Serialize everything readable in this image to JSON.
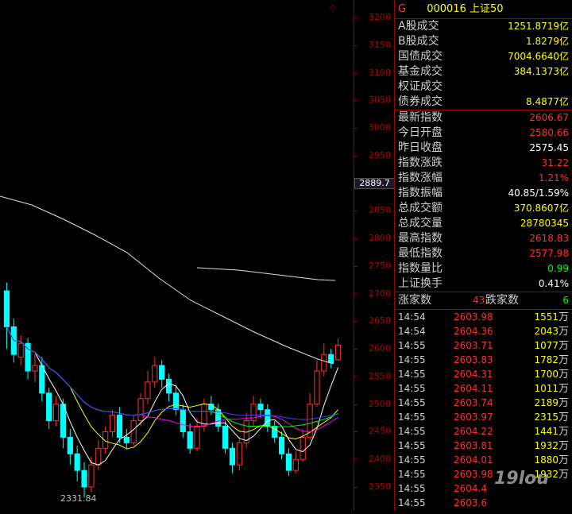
{
  "header": {
    "marker": "G",
    "title": "000016 上证50"
  },
  "axis": {
    "ticks": [
      "3200",
      "3150",
      "3100",
      "3050",
      "3000",
      "2950",
      "2900",
      "2850",
      "2800",
      "2750",
      "2700",
      "2650",
      "2600",
      "2550",
      "2500",
      "2450",
      "2400",
      "2350"
    ],
    "current_price_label": "2889.7",
    "low_label": "2331.84"
  },
  "stats": [
    {
      "label": "A股成交",
      "value": "1251.8719亿",
      "color": "yellow"
    },
    {
      "label": "B股成交",
      "value": "1.8279亿",
      "color": "yellow"
    },
    {
      "label": "国债成交",
      "value": "7004.6640亿",
      "color": "yellow"
    },
    {
      "label": "基金成交",
      "value": "384.1373亿",
      "color": "yellow"
    },
    {
      "label": "权证成交",
      "value": "",
      "color": "yellow"
    },
    {
      "label": "债券成交",
      "value": "8.4877亿",
      "color": "yellow"
    }
  ],
  "index": [
    {
      "label": "最新指数",
      "value": "2606.67",
      "color": "red"
    },
    {
      "label": "今日开盘",
      "value": "2580.66",
      "color": "red"
    },
    {
      "label": "昨日收盘",
      "value": "2575.45",
      "color": "white"
    },
    {
      "label": "指数涨跌",
      "value": "31.22",
      "color": "red"
    },
    {
      "label": "指数涨幅",
      "value": "1.21%",
      "color": "red"
    },
    {
      "label": "指数振幅",
      "value": "40.85/1.59%",
      "color": "white"
    },
    {
      "label": "总成交额",
      "value": "370.8607亿",
      "color": "yellow"
    },
    {
      "label": "总成交量",
      "value": "28780345",
      "color": "yellow"
    },
    {
      "label": "最高指数",
      "value": "2618.83",
      "color": "red"
    },
    {
      "label": "最低指数",
      "value": "2577.98",
      "color": "red"
    },
    {
      "label": "指数量比",
      "value": "0.99",
      "color": "green"
    },
    {
      "label": "上证换手",
      "value": "0.41%",
      "color": "white"
    }
  ],
  "advance": {
    "up_label": "涨家数",
    "up_value": "43",
    "down_label": "跌家数",
    "down_value": "6"
  },
  "ticks_table": [
    {
      "time": "14:54",
      "price": "2603.98",
      "vol": "1551",
      "unit": "万"
    },
    {
      "time": "14:54",
      "price": "2604.36",
      "vol": "2043",
      "unit": "万"
    },
    {
      "time": "14:55",
      "price": "2603.71",
      "vol": "1077",
      "unit": "万"
    },
    {
      "time": "14:55",
      "price": "2603.83",
      "vol": "1782",
      "unit": "万"
    },
    {
      "time": "14:55",
      "price": "2604.31",
      "vol": "1700",
      "unit": "万"
    },
    {
      "time": "14:55",
      "price": "2604.11",
      "vol": "1011",
      "unit": "万"
    },
    {
      "time": "14:55",
      "price": "2603.74",
      "vol": "2189",
      "unit": "万"
    },
    {
      "time": "14:55",
      "price": "2603.97",
      "vol": "2315",
      "unit": "万"
    },
    {
      "time": "14:55",
      "price": "2604.22",
      "vol": "1441",
      "unit": "万"
    },
    {
      "time": "14:55",
      "price": "2603.81",
      "vol": "1932",
      "unit": "万"
    },
    {
      "time": "14:55",
      "price": "2604.01",
      "vol": "1880",
      "unit": "万"
    },
    {
      "time": "14:55",
      "price": "2603.98",
      "vol": "1932",
      "unit": "万"
    },
    {
      "time": "14:55",
      "price": "2604.4",
      "vol": "",
      "unit": ""
    },
    {
      "time": "14:55",
      "price": "2603.6",
      "vol": "",
      "unit": ""
    }
  ],
  "watermark": "19lou",
  "candles": [
    [
      2705,
      2640,
      2720,
      2600
    ],
    [
      2640,
      2590,
      2655,
      2575
    ],
    [
      2585,
      2610,
      2625,
      2570
    ],
    [
      2610,
      2560,
      2620,
      2545
    ],
    [
      2560,
      2570,
      2590,
      2540
    ],
    [
      2570,
      2520,
      2585,
      2505
    ],
    [
      2520,
      2470,
      2530,
      2455
    ],
    [
      2470,
      2500,
      2515,
      2460
    ],
    [
      2500,
      2440,
      2510,
      2420
    ],
    [
      2440,
      2410,
      2455,
      2390
    ],
    [
      2410,
      2380,
      2425,
      2360
    ],
    [
      2380,
      2350,
      2395,
      2331
    ],
    [
      2350,
      2390,
      2405,
      2340
    ],
    [
      2390,
      2420,
      2435,
      2380
    ],
    [
      2420,
      2450,
      2460,
      2410
    ],
    [
      2450,
      2480,
      2490,
      2440
    ],
    [
      2480,
      2440,
      2495,
      2430
    ],
    [
      2440,
      2430,
      2455,
      2420
    ],
    [
      2430,
      2470,
      2480,
      2425
    ],
    [
      2470,
      2510,
      2520,
      2460
    ],
    [
      2510,
      2540,
      2560,
      2500
    ],
    [
      2540,
      2570,
      2585,
      2530
    ],
    [
      2570,
      2545,
      2580,
      2530
    ],
    [
      2545,
      2520,
      2555,
      2505
    ],
    [
      2520,
      2490,
      2535,
      2480
    ],
    [
      2490,
      2450,
      2500,
      2440
    ],
    [
      2450,
      2420,
      2465,
      2410
    ],
    [
      2420,
      2460,
      2475,
      2415
    ],
    [
      2460,
      2500,
      2510,
      2450
    ],
    [
      2500,
      2490,
      2515,
      2480
    ],
    [
      2490,
      2460,
      2500,
      2450
    ],
    [
      2460,
      2420,
      2470,
      2410
    ],
    [
      2420,
      2390,
      2430,
      2375
    ],
    [
      2390,
      2430,
      2440,
      2380
    ],
    [
      2430,
      2470,
      2485,
      2420
    ],
    [
      2470,
      2500,
      2515,
      2460
    ],
    [
      2500,
      2490,
      2510,
      2475
    ],
    [
      2490,
      2460,
      2500,
      2450
    ],
    [
      2460,
      2440,
      2470,
      2430
    ],
    [
      2440,
      2410,
      2450,
      2400
    ],
    [
      2410,
      2380,
      2420,
      2370
    ],
    [
      2380,
      2400,
      2415,
      2375
    ],
    [
      2400,
      2440,
      2455,
      2395
    ],
    [
      2440,
      2500,
      2520,
      2435
    ],
    [
      2500,
      2560,
      2580,
      2495
    ],
    [
      2560,
      2590,
      2610,
      2550
    ],
    [
      2590,
      2575,
      2600,
      2565
    ],
    [
      2580,
      2607,
      2619,
      2578
    ]
  ],
  "colors": {
    "up": "#ff3030",
    "down": "#00ffff",
    "grid": "#a00000",
    "text_axis": "#b00000"
  }
}
